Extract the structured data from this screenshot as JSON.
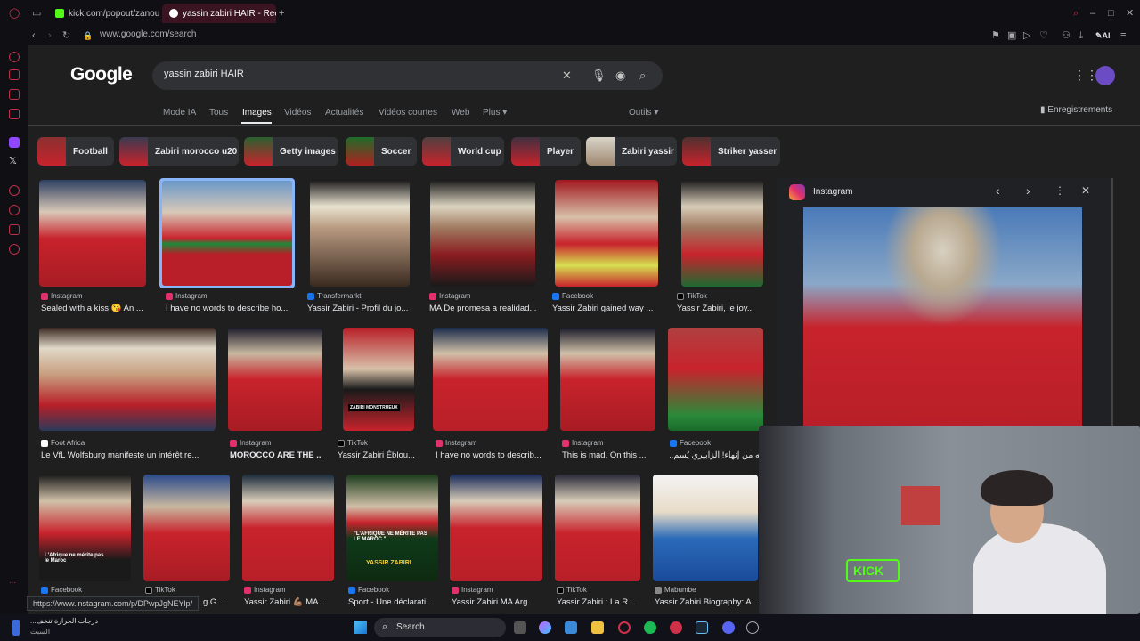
{
  "browser": {
    "tabs": [
      {
        "label": "kick.com/popout/zanoun"
      },
      {
        "label": "yassin zabiri HAIR - Reche"
      }
    ],
    "url": "www.google.com/search",
    "ai_label": "AI"
  },
  "google": {
    "logo": "Google",
    "query": "yassin zabiri HAIR",
    "nav": [
      "Mode IA",
      "Tous",
      "Images",
      "Vidéos",
      "Actualités",
      "Vidéos courtes",
      "Web",
      "Plus ▾"
    ],
    "tools": "Outils ▾",
    "saved": "Enregistrements",
    "chips": [
      "Football",
      "Zabiri morocco u20",
      "Getty images",
      "Soccer",
      "World cup",
      "Player",
      "Zabiri yassir",
      "Striker yasser"
    ]
  },
  "results": {
    "row1": [
      {
        "source": "Instagram",
        "caption": "Sealed with a kiss 😘 An ..."
      },
      {
        "source": "Instagram",
        "caption": "I have no words to describe ho..."
      },
      {
        "source": "Transfermarkt",
        "caption": "Yassir Zabiri - Profil du jo..."
      },
      {
        "source": "Instagram",
        "caption": "MA De promesa a realidad..."
      },
      {
        "source": "Facebook",
        "caption": "Yassir Zabiri gained way ..."
      },
      {
        "source": "TikTok",
        "caption": "Yassir Zabiri, le joy..."
      }
    ],
    "row2": [
      {
        "source": "Foot Africa",
        "caption": "Le VfL Wolfsburg manifeste un intérêt re..."
      },
      {
        "source": "Instagram",
        "caption": "MOROCCO ARE THE ..."
      },
      {
        "source": "TikTok",
        "caption": "Yassir Zabiri Éblou..."
      },
      {
        "source": "Instagram",
        "caption": "I have no words to describ..."
      },
      {
        "source": "Instagram",
        "caption": "This is mad. On this ..."
      },
      {
        "source": "Facebook",
        "caption": "له من إنهاء! الزابيري يُسم..."
      }
    ],
    "row3": [
      {
        "source": "Facebook",
        "caption": "g G..."
      },
      {
        "source": "TikTok",
        "caption": ""
      },
      {
        "source": "Instagram",
        "caption": "Yassir Zabiri 💪🏽 MA..."
      },
      {
        "source": "Facebook",
        "caption": "Sport - Une déclarati..."
      },
      {
        "source": "Instagram",
        "caption": "Yassir Zabiri MA Arg..."
      },
      {
        "source": "TikTok",
        "caption": "Yassir Zabiri : La R..."
      },
      {
        "source": "Mabumbe",
        "caption": "Yassir Zabiri Biography: A..."
      }
    ],
    "tile_texts": {
      "afrique": "L'Afrique ne mérite pas le Maroc",
      "quote": "\"L'AFRIQUE NE MÉRITE PAS LE MAROC.\"",
      "name": "YASSIR ZABIRI",
      "monstrueux": "ZABIRI MONSTRUEUX"
    }
  },
  "panel": {
    "source": "Instagram"
  },
  "status_url": "https://www.instagram.com/p/DPwpJgNEYlp/",
  "taskbar": {
    "weather": "...درجات الحرارة تنخف",
    "weather_sub": "السبت",
    "search": "Search"
  },
  "webcam": {
    "sign": "KICK"
  },
  "colors": {
    "accent": "#8ab4f8",
    "kick_green": "#53fc18",
    "jersey_red": "#c8232c"
  }
}
